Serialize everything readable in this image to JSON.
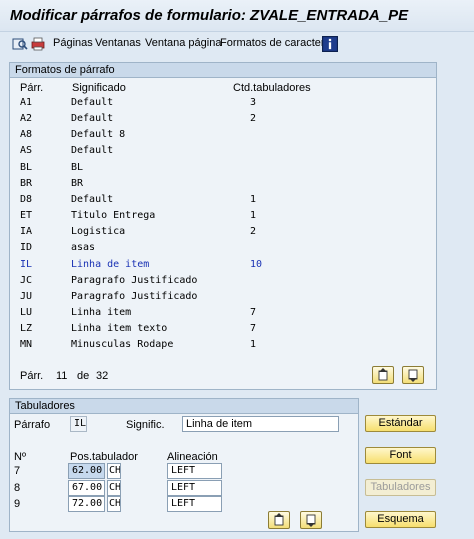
{
  "window": {
    "title": "Modificar párrafos de formulario: ZVALE_ENTRADA_PE"
  },
  "toolbar": {
    "icons": [
      "display-icon",
      "print-icon"
    ],
    "menu": [
      "Páginas",
      "Ventanas",
      "Ventana página",
      "Formatos de caracteres"
    ],
    "info_icon": "info-icon"
  },
  "paragraph_formats": {
    "title": "Formatos de párrafo",
    "headers": {
      "code": "Párr.",
      "meaning": "Significado",
      "tabs": "Ctd.tabuladores"
    },
    "rows": [
      {
        "code": "A1",
        "meaning": "Default",
        "tabs": "3"
      },
      {
        "code": "A2",
        "meaning": "Default",
        "tabs": "2"
      },
      {
        "code": "A8",
        "meaning": "Default 8",
        "tabs": ""
      },
      {
        "code": "AS",
        "meaning": "Default",
        "tabs": ""
      },
      {
        "code": "BL",
        "meaning": "BL",
        "tabs": ""
      },
      {
        "code": "BR",
        "meaning": "BR",
        "tabs": ""
      },
      {
        "code": "D8",
        "meaning": "Default",
        "tabs": "1"
      },
      {
        "code": "ET",
        "meaning": "Titulo Entrega",
        "tabs": "1"
      },
      {
        "code": "IA",
        "meaning": "Logistica",
        "tabs": "2"
      },
      {
        "code": "ID",
        "meaning": "asas",
        "tabs": ""
      },
      {
        "code": "IL",
        "meaning": "Linha de item",
        "tabs": "10",
        "selected": true
      },
      {
        "code": "JC",
        "meaning": "Paragrafo Justificado",
        "tabs": ""
      },
      {
        "code": "JU",
        "meaning": "Paragrafo Justificado",
        "tabs": ""
      },
      {
        "code": "LU",
        "meaning": "Linha item",
        "tabs": "7"
      },
      {
        "code": "LZ",
        "meaning": "Linha item texto",
        "tabs": "7"
      },
      {
        "code": "MN",
        "meaning": "Minusculas Rodape",
        "tabs": "1"
      }
    ],
    "footer": {
      "label": "Párr.",
      "current": "11",
      "of": "de",
      "total": "32"
    }
  },
  "tabulators": {
    "title": "Tabuladores",
    "paragraph_label": "Párrafo",
    "paragraph_value": "IL",
    "meaning_label": "Signific.",
    "meaning_value": "Linha de item",
    "headers": {
      "num": "Nº",
      "pos": "Pos.tabulador",
      "align": "Alineación"
    },
    "rows": [
      {
        "num": "7",
        "pos": "62.00",
        "unit": "CH",
        "align": "LEFT",
        "highlight": true
      },
      {
        "num": "8",
        "pos": "67.00",
        "unit": "CH",
        "align": "LEFT"
      },
      {
        "num": "9",
        "pos": "72.00",
        "unit": "CH",
        "align": "LEFT"
      }
    ]
  },
  "side_buttons": {
    "standard": "Estándar",
    "font": "Font",
    "tabulators": "Tabuladores",
    "scheme": "Esquema"
  }
}
